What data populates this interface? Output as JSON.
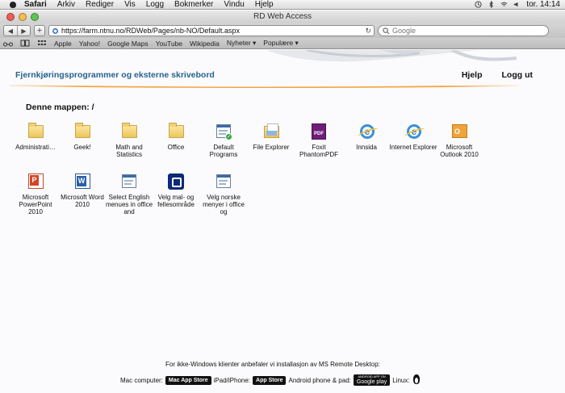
{
  "menubar": {
    "items": [
      "Safari",
      "Arkiv",
      "Rediger",
      "Vis",
      "Logg",
      "Bokmerker",
      "Vindu",
      "Hjelp"
    ],
    "clock": "tor. 14:14"
  },
  "window": {
    "title": "RD Web Access"
  },
  "toolbar": {
    "url": "https://farm.ntnu.no/RDWeb/Pages/nb-NO/Default.aspx",
    "search_placeholder": "Google"
  },
  "bookmarks": [
    "Apple",
    "Yahoo!",
    "Google Maps",
    "YouTube",
    "Wikipedia",
    "Nyheter ▾",
    "Populære ▾"
  ],
  "page": {
    "site_title": "Fjernkjøringsprogrammer og eksterne skrivebord",
    "help_link": "Hjelp",
    "logout_link": "Logg ut",
    "folder_label": "Denne mappen: /"
  },
  "apps": [
    {
      "label": "Administrati…",
      "icon": "folder-icon"
    },
    {
      "label": "Geek!",
      "icon": "folder-icon"
    },
    {
      "label": "Math and Statistics",
      "icon": "folder-icon"
    },
    {
      "label": "Office",
      "icon": "folder-icon"
    },
    {
      "label": "Default Programs",
      "icon": "default-programs-icon"
    },
    {
      "label": "File Explorer",
      "icon": "file-explorer-icon"
    },
    {
      "label": "Foxit PhantomPDF",
      "icon": "foxit-pdf-icon"
    },
    {
      "label": "Innsida",
      "icon": "internet-explorer-icon"
    },
    {
      "label": "Internet Explorer",
      "icon": "internet-explorer-icon"
    },
    {
      "label": "Microsoft Outlook 2010",
      "icon": "outlook-icon"
    },
    {
      "label": "Microsoft PowerPoint 2010",
      "icon": "powerpoint-icon"
    },
    {
      "label": "Microsoft Word 2010",
      "icon": "word-icon"
    },
    {
      "label": "Select English menues in office and",
      "icon": "app-window-icon"
    },
    {
      "label": "Velg mal- og fellesområde",
      "icon": "velg-mal-icon"
    },
    {
      "label": "Velg norske menyer i office og",
      "icon": "app-window-icon"
    }
  ],
  "footer": {
    "line1": "For ikke-Windows klienter anbefaler vi installasjon av MS Remote Desktop:",
    "mac_label": "Mac computer:",
    "mac_badge": "Mac App Store",
    "ipad_label": "iPad/iPhone:",
    "ipad_badge": "App Store",
    "android_label": "Android phone & pad:",
    "gplay_small": "ANDROID APP ON",
    "gplay_big": "Google play",
    "linux_label": "Linux:"
  },
  "colors": {
    "title_blue": "#27628f",
    "rule_orange": "#f29a2e"
  }
}
